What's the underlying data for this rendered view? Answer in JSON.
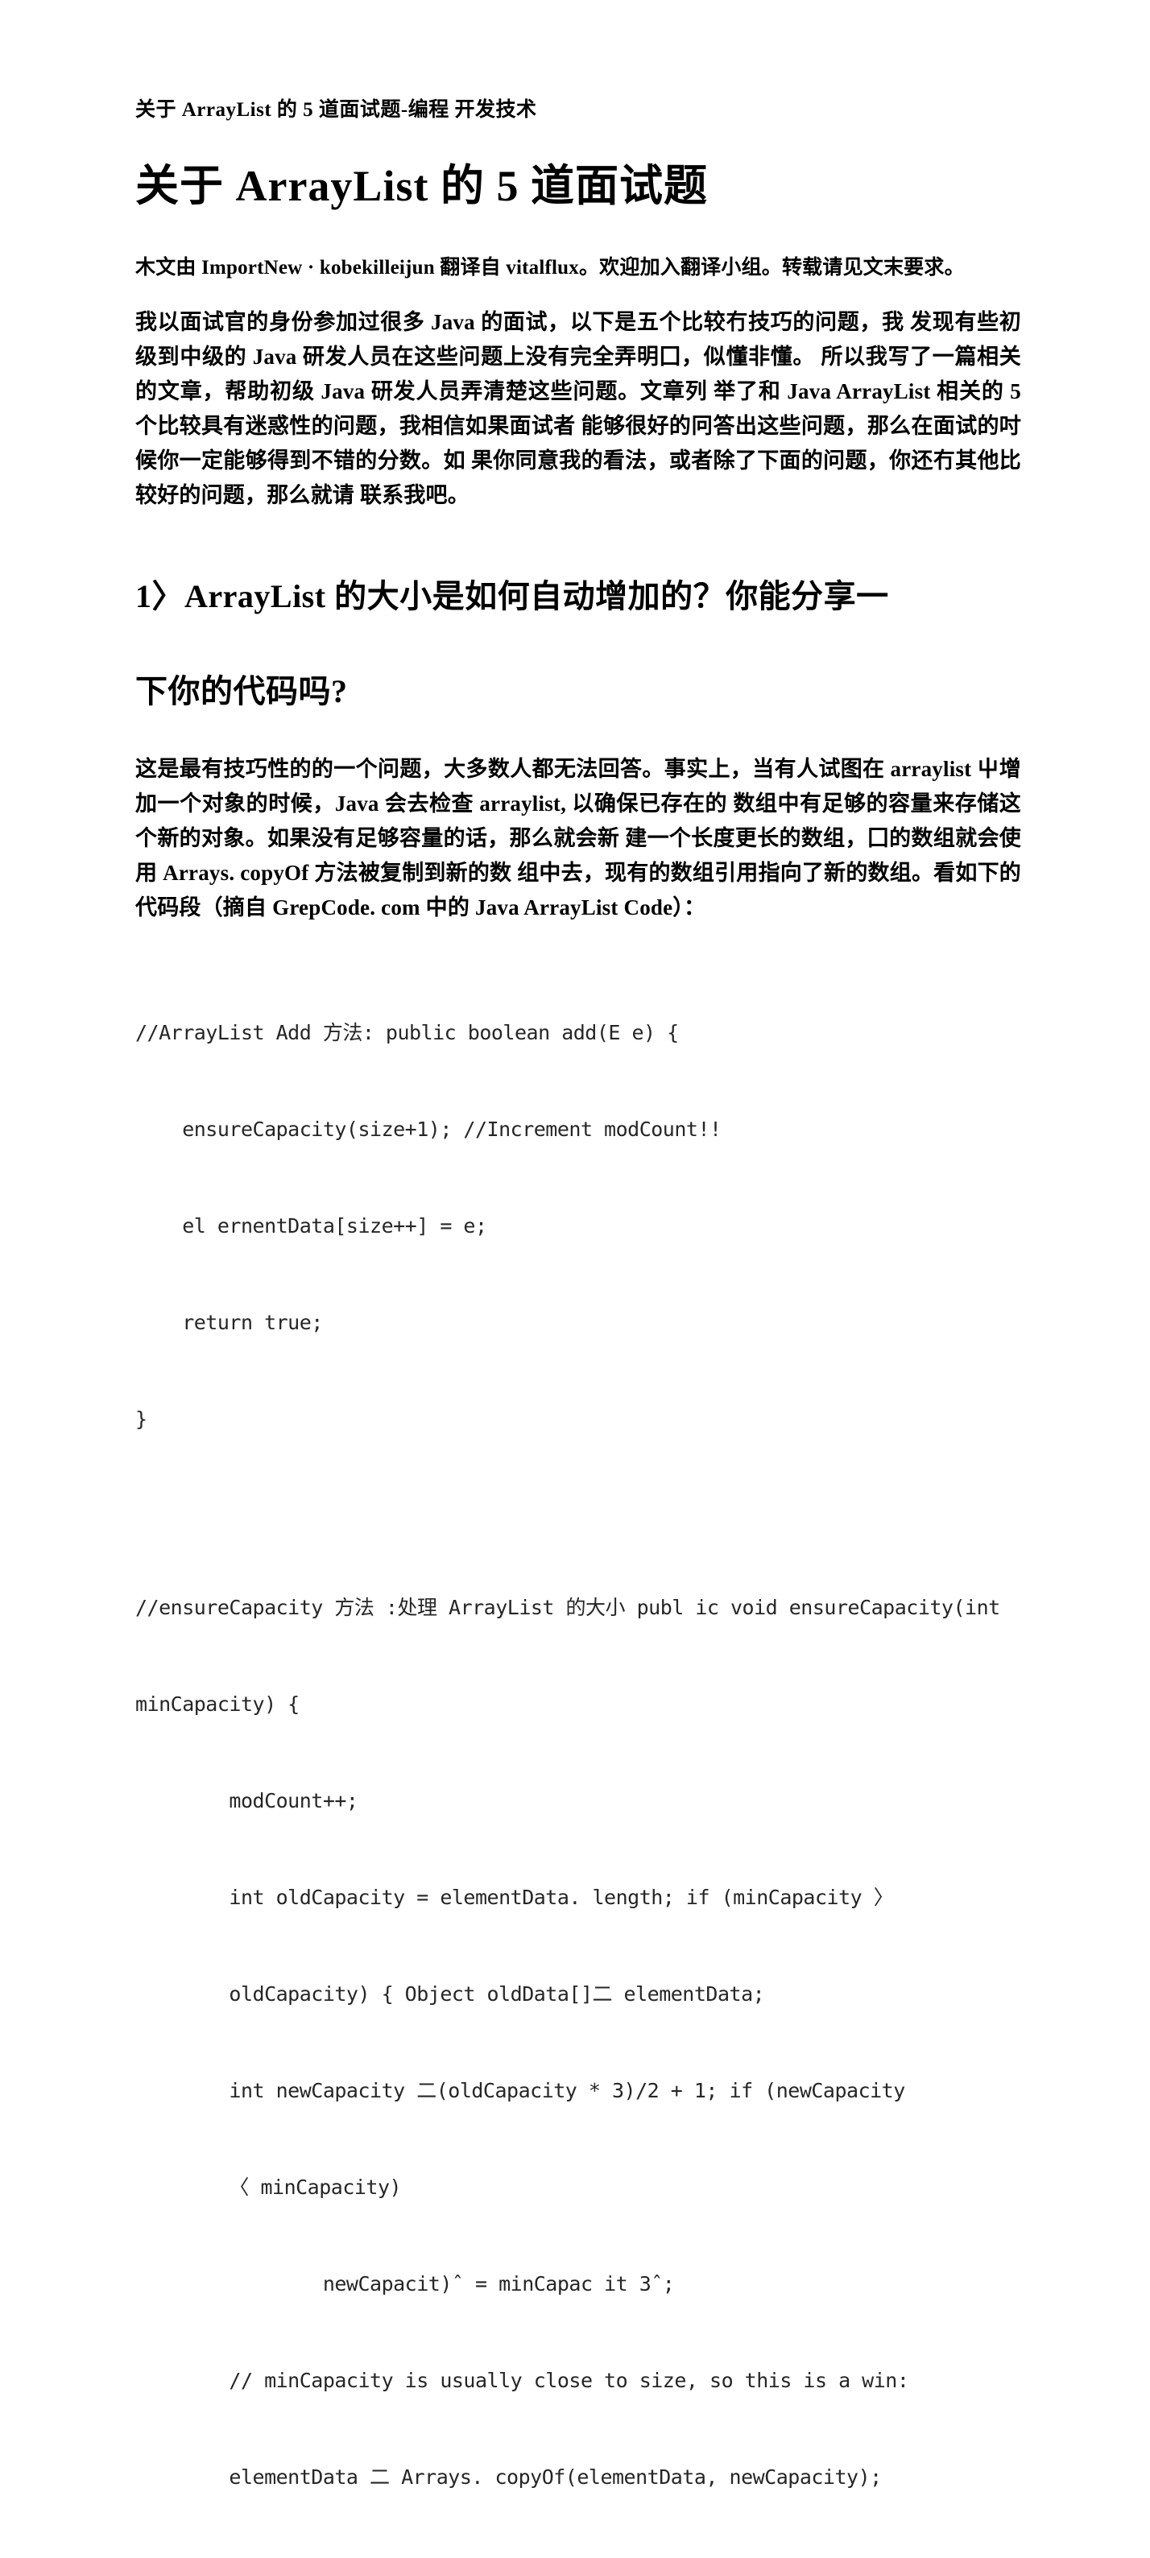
{
  "document": {
    "running_header": "关于 ArrayList 的 5 道面试题-编程 开发技术",
    "title": "关于 ArrayList 的 5 道面试题",
    "credits": "木文由 ImportNew · kobekilleijun 翻译自 vitalflux。欢迎加入翻译小组。转载请见文末要求。",
    "intro_paragraph": "我以面试官的身份参加过很多 Java 的面试，以下是五个比较冇技巧的问题，我 发现有些初级到中级的 Java 研发人员在这些问题上没有完全弄明囗，似懂非懂。 所以我写了一篇相关的文章，帮助初级 Java 研发人员弄清楚这些问题。文章列 举了和 Java ArrayList 相关的 5 个比较具有迷惑性的问题，我相信如果面试者 能够很好的冋答出这些问题，那么在面试的吋候你一定能够得到不错的分数。如 果你同意我的看法，或者除了下面的问题，你还冇其他比较好的问题，那么就请 联系我吧。",
    "section_1": {
      "heading_line_1": "1〉ArrayList 的大小是如何自动增加的？你能分享一",
      "heading_line_2": "下你的代码吗?",
      "answer_paragraph": "这是最有技巧性的的一个问题，大多数人都无法回答。事实上，当有人试图在 arraylist 屮增加一个对象的时候，Java 会去检查 arraylist, 以确保已存在的 数组中有足够的容量来存储这个新的对象。如果没有足够容量的话，那么就会新 建一个长度更长的数组，囗的数组就会使用 Arrays. copyOf 方法被复制到新的数 组中去，现有的数组引用指向了新的数组。看如下的代码段（摘自 GrepCode. com 中的 Java ArrayList Code）：",
      "code_block_1": [
        "//ArrayList Add 方法: public boolean add(E e) {",
        "    ensureCapacity(size+1); //Increment modCount!!",
        "    el ernentData[size++] = e;",
        "    return true;",
        "}"
      ],
      "code_block_2": [
        "//ensureCapacity 方法 :处理 ArrayList 的大小 publ ic void ensureCapacity(int",
        "minCapacity) {",
        "        modCount++;",
        "        int oldCapacity = elementData. length; if (minCapacity 〉",
        "        oldCapacity) { Object oldData[]二 elementData;",
        "        int newCapacity 二(oldCapacity * 3)/2 + 1; if (newCapacity",
        "        〈 minCapacity)",
        "                newCapacit)ˆ = minCapac it 3ˆ;",
        "        // minCapacity is usually close to size, so this is a win:",
        "        elementData 二 Arrays. copyOf(elementData, newCapacity);"
      ]
    }
  }
}
